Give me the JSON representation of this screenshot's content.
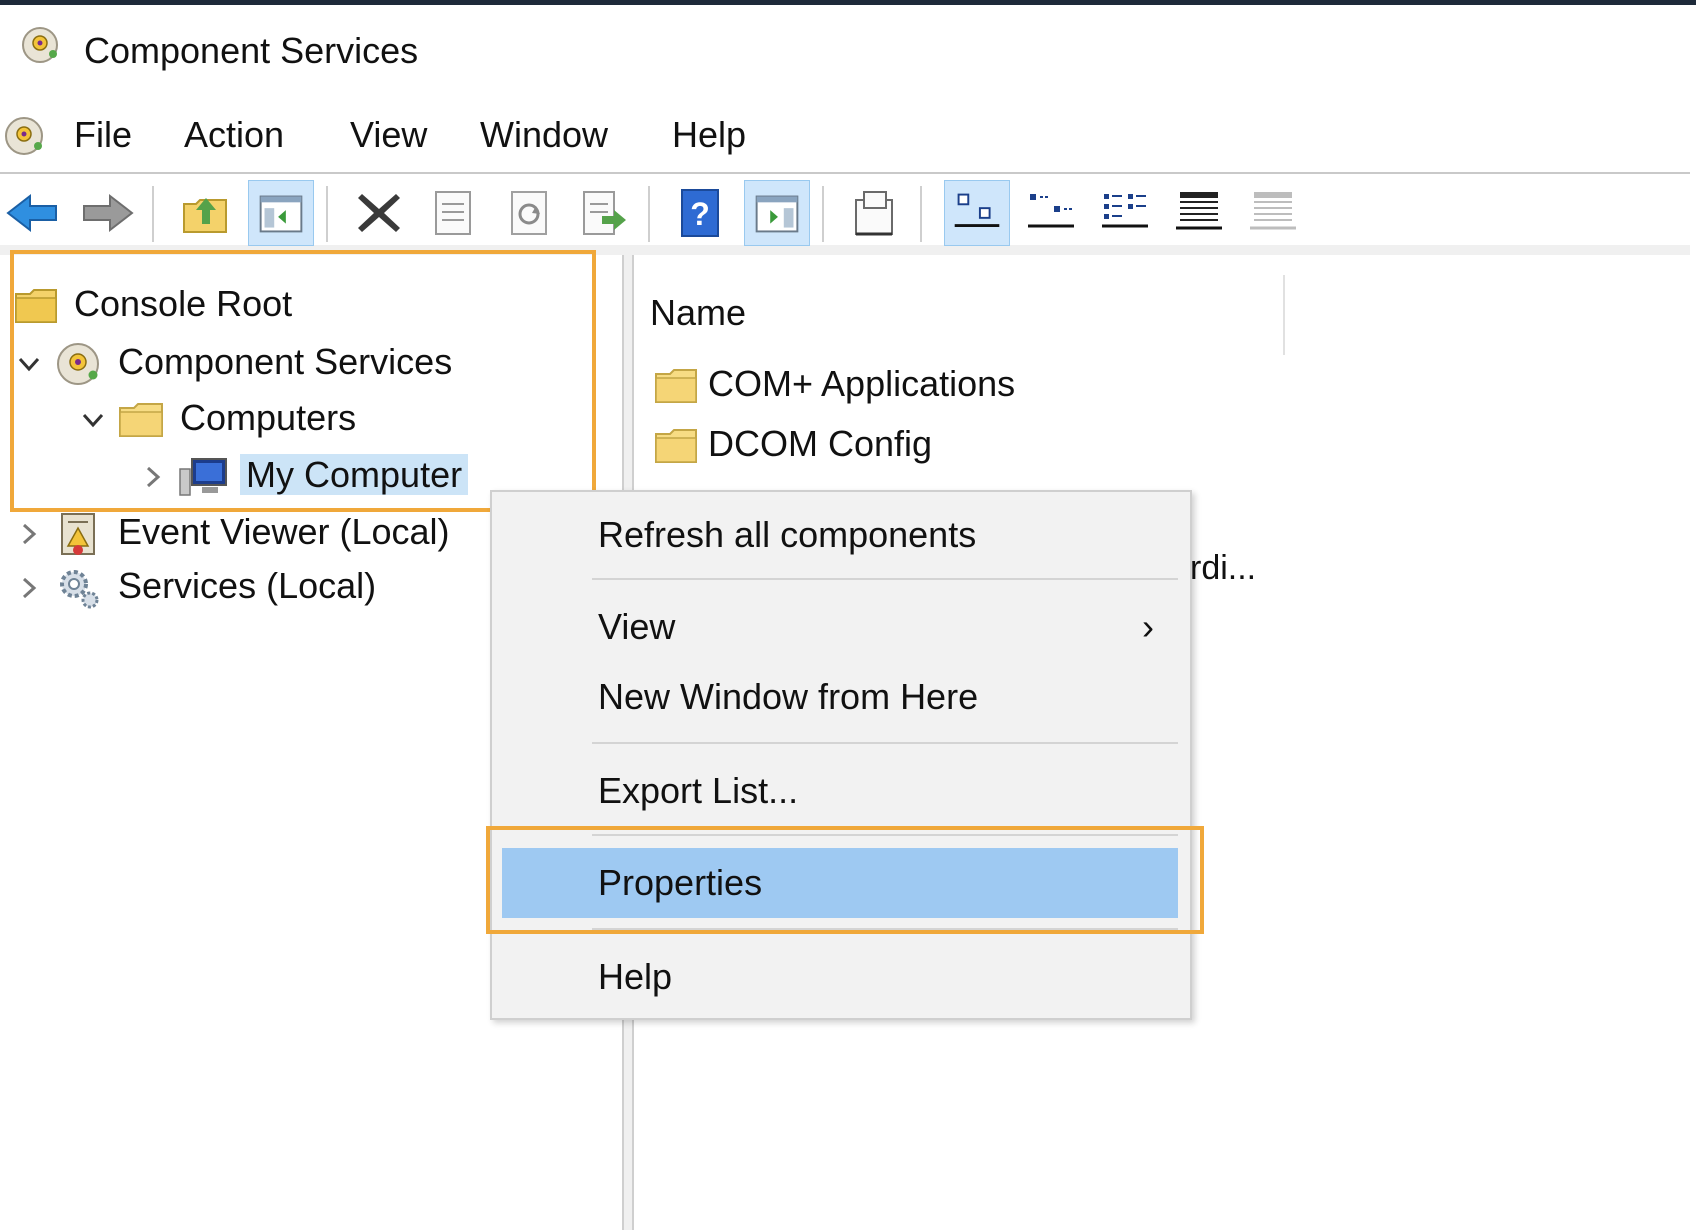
{
  "window": {
    "title": "Component Services",
    "icon": "component-services-icon"
  },
  "menu": {
    "items": [
      "File",
      "Action",
      "View",
      "Window",
      "Help"
    ]
  },
  "toolbar": {
    "buttons": [
      "back-arrow-icon",
      "forward-arrow-icon",
      "up-folder-icon",
      "show-hide-console-tree-icon",
      "delete-icon",
      "properties-icon",
      "refresh-icon",
      "export-list-icon",
      "help-icon",
      "show-hide-action-pane-icon",
      "new-window-icon",
      "large-icons-view-icon",
      "small-icons-view-icon",
      "list-view-icon",
      "detail-view-icon",
      "status-view-icon"
    ]
  },
  "tree": {
    "items": [
      {
        "label": "Console Root",
        "icon": "folder-icon"
      },
      {
        "label": "Component Services",
        "icon": "component-services-icon",
        "expanded": true
      },
      {
        "label": "Computers",
        "icon": "folder-icon",
        "expanded": true
      },
      {
        "label": "My Computer",
        "icon": "computer-icon",
        "selected": true
      },
      {
        "label": "Event Viewer (Local)",
        "icon": "event-viewer-icon"
      },
      {
        "label": "Services (Local)",
        "icon": "services-gear-icon"
      }
    ]
  },
  "list": {
    "column_header": "Name",
    "items": [
      {
        "label": "COM+ Applications",
        "icon": "folder-icon"
      },
      {
        "label": "DCOM Config",
        "icon": "folder-icon"
      }
    ],
    "partial_text": "rdi..."
  },
  "context_menu": {
    "items": [
      {
        "label": "Refresh all components"
      },
      {
        "label": "View",
        "submenu": true,
        "submenu_arrow": "›"
      },
      {
        "label": "New Window from Here"
      },
      {
        "label": "Export List..."
      },
      {
        "label": "Properties",
        "highlighted": true
      },
      {
        "label": "Help"
      }
    ]
  },
  "colors": {
    "highlight_box": "#f0a83a",
    "menu_selection": "#9ec9f2",
    "tree_selection": "#cce4f7"
  }
}
